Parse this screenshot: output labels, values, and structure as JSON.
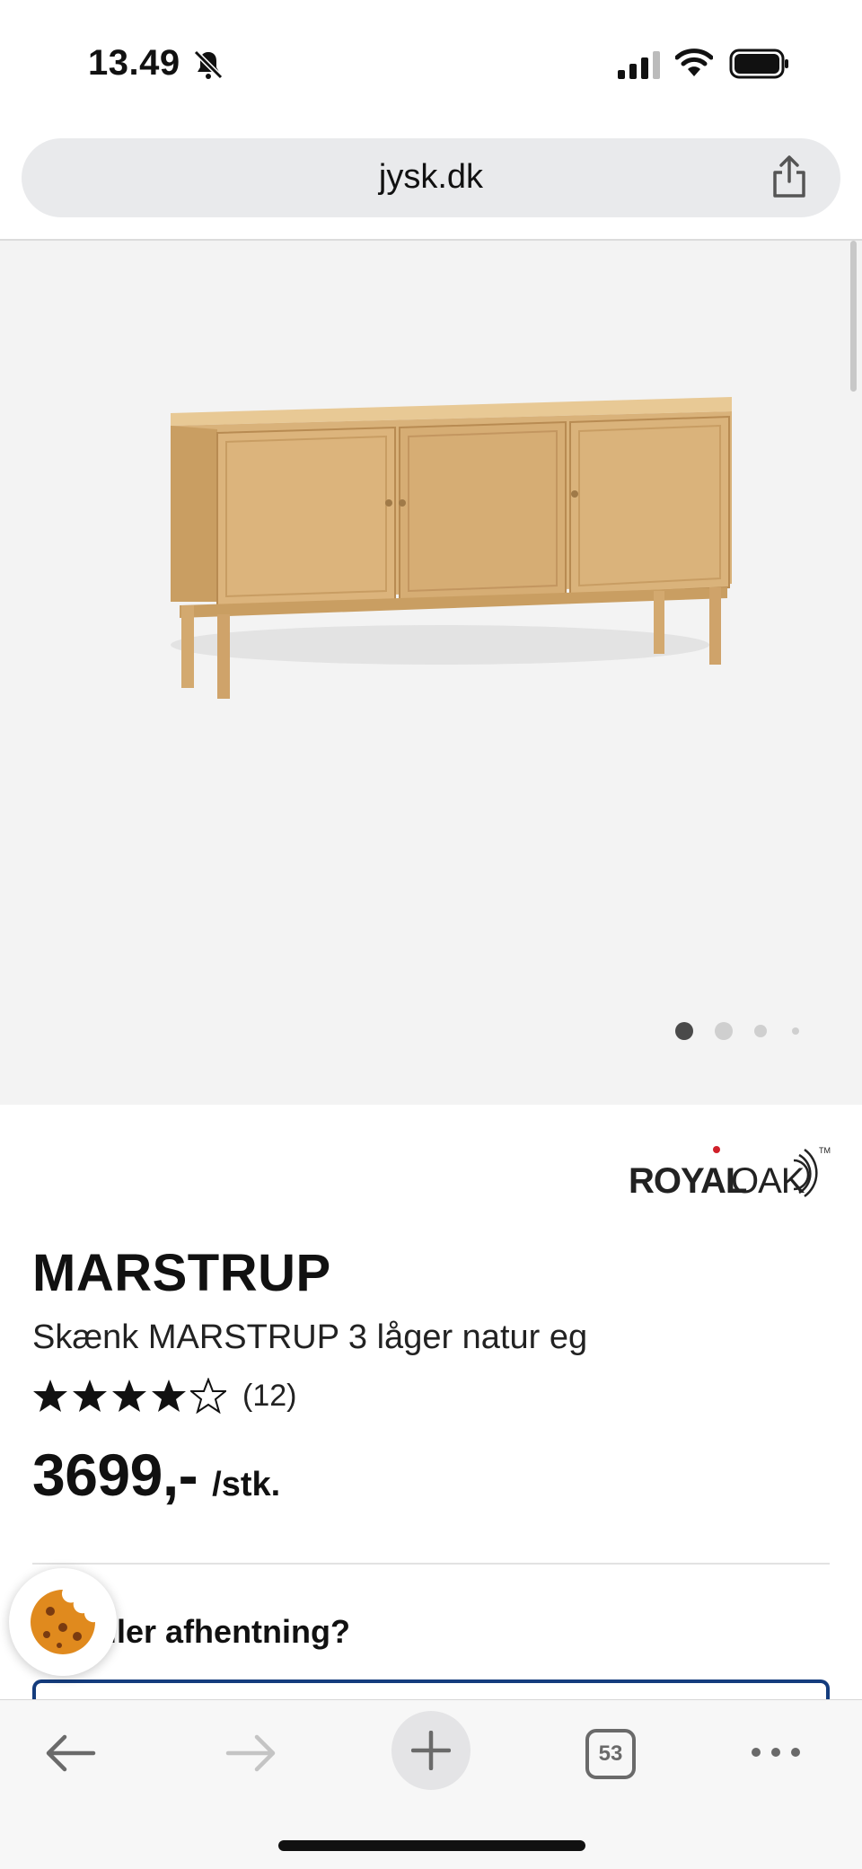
{
  "status_bar": {
    "time": "13.49",
    "icons": [
      "bell-slash-icon",
      "signal-icon",
      "wifi-icon",
      "battery-icon"
    ]
  },
  "browser": {
    "url": "jysk.dk",
    "share_icon": "share-icon",
    "open_tabs": "53"
  },
  "carousel": {
    "images": 4,
    "active_index": 1,
    "background": "#f3f3f3"
  },
  "product": {
    "brand_logo_text": "ROYAL OAK",
    "name": "MARSTRUP",
    "description": "Skænk MARSTRUP 3 låger natur eg",
    "rating_stars": 4,
    "rating_max": 5,
    "rating_count": "(12)",
    "price": "3699,-",
    "price_unit": "/stk."
  },
  "delivery": {
    "heading": "ing eller afhentning?"
  },
  "toolbar": {
    "icons": [
      "back-arrow-icon",
      "forward-arrow-icon",
      "new-tab-icon",
      "tabs-icon",
      "more-icon"
    ]
  },
  "colors": {
    "accent_navy": "#143c7d",
    "brand_red": "#d0202a",
    "wood": "#d9b27a"
  }
}
